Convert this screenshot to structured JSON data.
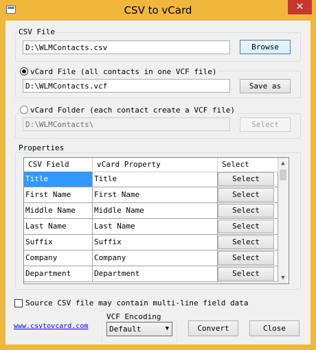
{
  "window": {
    "title": "CSV to vCard"
  },
  "csv_file": {
    "group_label": "CSV File",
    "path": "D:\\WLMContacts.csv",
    "browse_label": "Browse"
  },
  "vcard_file": {
    "radio_label": "vCard File (all contacts in one VCF file)",
    "path": "D:\\WLMContacts.vcf",
    "save_label": "Save as"
  },
  "vcard_folder": {
    "radio_label": "vCard Folder (each contact create a VCF file)",
    "path": "D:\\WLMContacts\\",
    "select_label": "Select"
  },
  "properties": {
    "group_label": "Properties",
    "columns": [
      "CSV Field",
      "vCard Property",
      "Select"
    ],
    "rows": [
      {
        "csv": "Title",
        "vcard": "Title",
        "btn": "Select"
      },
      {
        "csv": "First Name",
        "vcard": "First Name",
        "btn": "Select"
      },
      {
        "csv": "Middle Name",
        "vcard": "Middle Name",
        "btn": "Select"
      },
      {
        "csv": "Last Name",
        "vcard": "Last Name",
        "btn": "Select"
      },
      {
        "csv": "Suffix",
        "vcard": "Suffix",
        "btn": "Select"
      },
      {
        "csv": "Company",
        "vcard": "Company",
        "btn": "Select"
      },
      {
        "csv": "Department",
        "vcard": "Department",
        "btn": "Select"
      }
    ]
  },
  "multiline": {
    "label": "Source CSV file may contain multi-line field data"
  },
  "footer": {
    "link": "www.csvtovcard.com",
    "encoding_label": "VCF Encoding",
    "encoding_value": "Default",
    "convert_label": "Convert",
    "close_label": "Close"
  },
  "colors": {
    "title_bar": "#f0b73c",
    "selection": "#3399ff",
    "close_button": "#c7372f"
  }
}
